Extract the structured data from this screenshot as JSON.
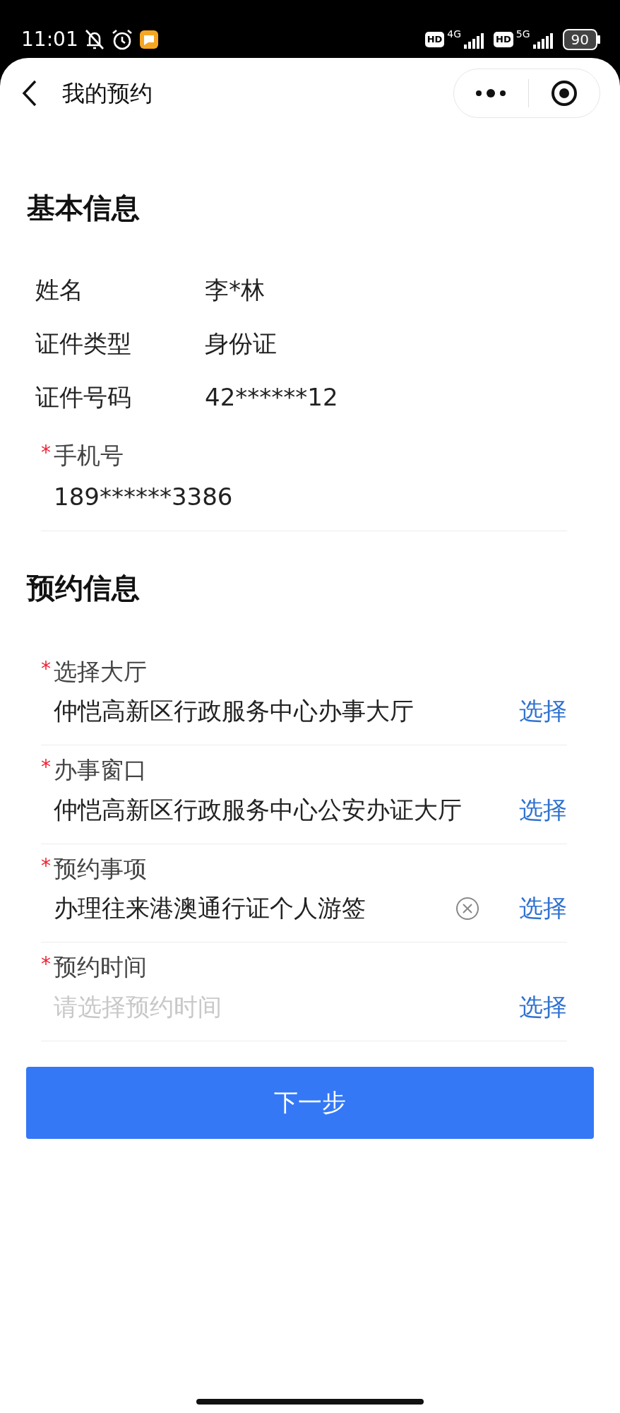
{
  "status_bar": {
    "time": "11:01",
    "hd_1": "HD",
    "network_1": "4G",
    "hd_2": "HD",
    "network_2": "5G",
    "battery": "90"
  },
  "header": {
    "title": "我的预约"
  },
  "basic_info": {
    "title": "基本信息",
    "rows": [
      {
        "label": "姓名",
        "value": "李*林"
      },
      {
        "label": "证件类型",
        "value": "身份证"
      },
      {
        "label": "证件号码",
        "value": "42******12"
      }
    ],
    "phone": {
      "required_mark": "*",
      "label": "手机号",
      "value": "189******3386"
    }
  },
  "booking_info": {
    "title": "预约信息",
    "fields": [
      {
        "required_mark": "*",
        "label": "选择大厅",
        "value": "仲恺高新区行政服务中心办事大厅",
        "clearable": false,
        "action": "选择"
      },
      {
        "required_mark": "*",
        "label": "办事窗口",
        "value": "仲恺高新区行政服务中心公安办证大厅",
        "clearable": false,
        "action": "选择"
      },
      {
        "required_mark": "*",
        "label": "预约事项",
        "value": "办理往来港澳通行证个人游签",
        "clearable": true,
        "action": "选择"
      },
      {
        "required_mark": "*",
        "label": "预约时间",
        "placeholder": "请选择预约时间",
        "clearable": false,
        "action": "选择"
      }
    ]
  },
  "next_button": "下一步"
}
